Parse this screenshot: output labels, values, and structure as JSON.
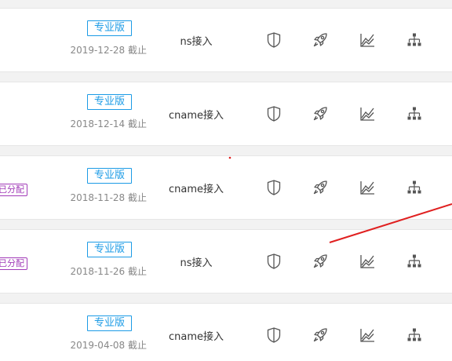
{
  "rows": [
    {
      "plan": "专业版",
      "date": "2019-12-28 截止",
      "access": "ns接入",
      "tag": ""
    },
    {
      "plan": "专业版",
      "date": "2018-12-14 截止",
      "access": "cname接入",
      "tag": ""
    },
    {
      "plan": "专业版",
      "date": "2018-11-28 截止",
      "access": "cname接入",
      "tag": "已分配"
    },
    {
      "plan": "专业版",
      "date": "2018-11-26 截止",
      "access": "ns接入",
      "tag": "已分配"
    },
    {
      "plan": "专业版",
      "date": "2019-04-08 截止",
      "access": "cname接入",
      "tag": ""
    }
  ],
  "icons": [
    "shield-icon",
    "rocket-icon",
    "trend-chart-icon",
    "sitemap-icon"
  ],
  "colors": {
    "badge": "#1c9be6",
    "tag": "#a23bb8",
    "icon": "#555555",
    "annotation": "#e02020"
  }
}
